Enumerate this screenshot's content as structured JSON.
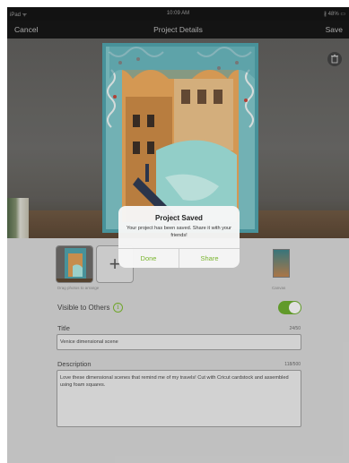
{
  "status_bar": {
    "carrier": "iPad ᯤ",
    "time": "10:09 AM",
    "battery": "∦ 48% ▭"
  },
  "navbar": {
    "cancel_label": "Cancel",
    "title": "Project Details",
    "save_label": "Save"
  },
  "photo": {
    "trash_icon": "trash-icon"
  },
  "alert": {
    "title": "Project Saved",
    "message": "Your project has been saved. Share it with your friends!",
    "done_label": "Done",
    "share_label": "Share"
  },
  "thumbnails": {
    "add_label": "+",
    "drag_hint": "Drag photos to arrange",
    "canvas_label": "Canvas"
  },
  "visibility": {
    "label": "Visible to Others",
    "info_icon": "i",
    "enabled": true
  },
  "title_field": {
    "label": "Title",
    "count": "24/50",
    "value": "Venice dimensional scene"
  },
  "description_field": {
    "label": "Description",
    "count": "118/500",
    "value": "Love these dimensional scenes that remind me of my travels! Cut with Cricut cardstock and assembled using foam squares."
  },
  "colors": {
    "accent": "#7ab52f",
    "toggle_on": "#6aa82e",
    "navbar": "#161616"
  }
}
